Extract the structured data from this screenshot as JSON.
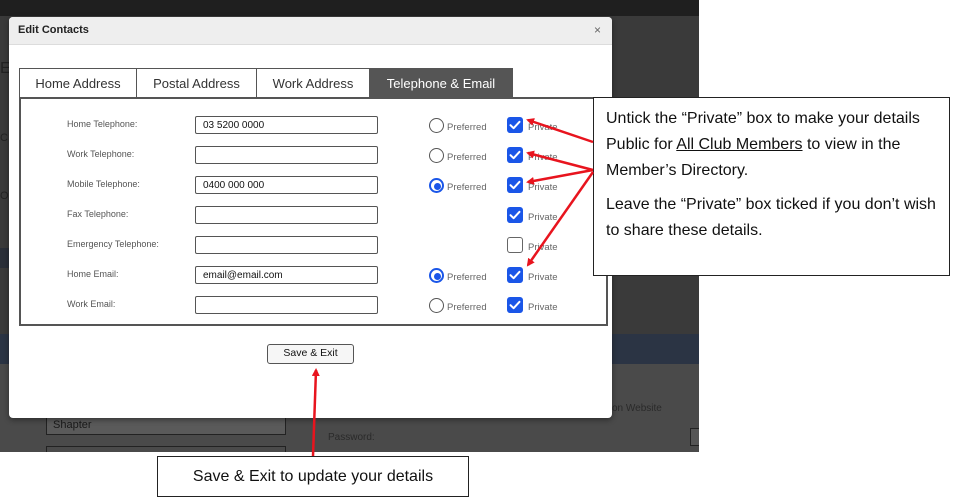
{
  "modal": {
    "title": "Edit Contacts",
    "close_glyph": "×",
    "tabs": [
      {
        "label": "Home Address",
        "active": false
      },
      {
        "label": "Postal Address",
        "active": false
      },
      {
        "label": "Work Address",
        "active": false
      },
      {
        "label": "Telephone & Email",
        "active": true
      }
    ],
    "rows": [
      {
        "label": "Home Telephone:",
        "value": "03 5200 0000",
        "has_preferred": true,
        "preferred": false,
        "private": true
      },
      {
        "label": "Work Telephone:",
        "value": "",
        "has_preferred": true,
        "preferred": false,
        "private": true
      },
      {
        "label": "Mobile Telephone:",
        "value": "0400 000 000",
        "has_preferred": true,
        "preferred": true,
        "private": true
      },
      {
        "label": "Fax Telephone:",
        "value": "",
        "has_preferred": false,
        "preferred": false,
        "private": true
      },
      {
        "label": "Emergency Telephone:",
        "value": "",
        "has_preferred": false,
        "preferred": false,
        "private": false
      },
      {
        "label": "Home Email:",
        "value": "email@email.com",
        "has_preferred": true,
        "preferred": true,
        "private": true
      },
      {
        "label": "Work Email:",
        "value": "",
        "has_preferred": true,
        "preferred": false,
        "private": true
      }
    ],
    "preferred_label": "Preferred",
    "private_label": "Private",
    "save_label": "Save & Exit"
  },
  "background": {
    "shapter": "Shapter",
    "password_label": "Password:",
    "on_website": "on Website",
    "left_e": "E",
    "left_c": "C",
    "left_o": "O"
  },
  "callout_right": {
    "p1_a": "Untick the “Private” box to make your details Public for ",
    "p1_link": "All Club Members",
    "p1_b": " to view in the Member’s Directory.",
    "p2": "Leave the “Private” box ticked if you don’t wish to share these details."
  },
  "callout_bottom": {
    "text": "Save & Exit to update your details"
  },
  "colors": {
    "accent_blue": "#1a56e8",
    "arrow_red": "#e8141e",
    "active_tab": "#555555"
  }
}
